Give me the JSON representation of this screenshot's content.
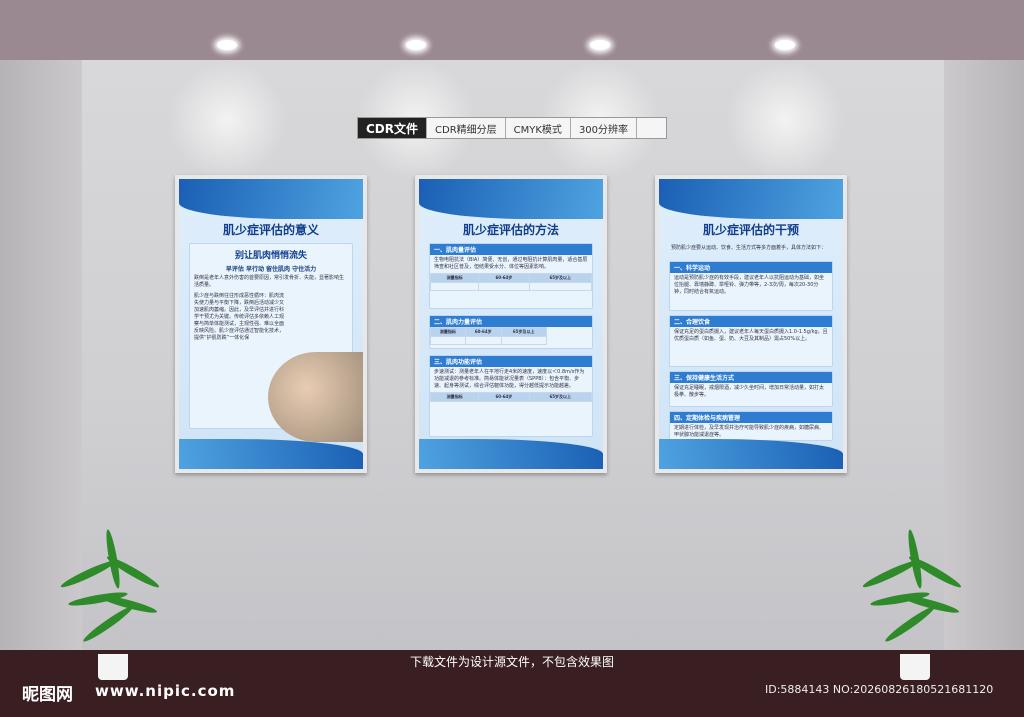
{
  "top_tags": [
    "CDR文件",
    "CDR精细分层",
    "CMYK模式",
    "300分辨率"
  ],
  "boards": [
    {
      "title": "肌少症评估的意义",
      "heading": "别让肌肉悄悄流失",
      "slogan": "早评估 早行动 留住肌肉 守住活力",
      "paragraphs": [
        "跌倒是老年人意外伤害的首要原因，常引发骨折、失能，显著影响生活质量。",
        "肌少症与跌倒往往形成恶性循环：肌肉流失使力量与平衡下降，跌倒后活动减少又加速肌肉萎缩。因此，及早评估并进行科学干预尤为关键。传统评估多依赖人工观察与简单体能测试，主观性强、难以全面反映风险。肌少症评估通过智能化技术，提供“护肌防跌”一体化保"
      ]
    },
    {
      "title": "肌少症评估的方法",
      "sections": [
        {
          "h": "一、肌肉量评估",
          "text": "生物电阻抗法（BIA）简便、无创，通过电阻抗计算肌肉量，适合基层筛查和社区普及，但结果受水分、体位等因素影响。"
        },
        {
          "h": "二、肌肉力量评估",
          "text": ""
        },
        {
          "h": "三、肌肉功能评估",
          "text": "步速测试：测量老年人在平地行走4米的速度，速度以＜0.8m/s作为功能减退的参考标准。简易体能状况量表（SPPB）：包含平衡、步速、起身等测试，综合评估躯体功能，得分越低提示功能越差。"
        }
      ],
      "table_headers": [
        "测量指标",
        "60-64岁",
        "65岁及以上"
      ]
    },
    {
      "title": "肌少症评估的干预",
      "intro": "预防肌少症要从运动、饮食、生活方式等多方面着手，具体方法如下：",
      "sections": [
        {
          "h": "一、科学运动",
          "text": "运动是预防肌少症的有效手段，建议老年人以抗阻运动为基础，如坐位抬腿、靠墙静蹲、举哑铃、弹力带等，2-3次/周，每次20-30分钟，同时结合有氧运动。"
        },
        {
          "h": "二、合理饮食",
          "text": "保证充足的蛋白质摄入，建议老年人每天蛋白质摄入1.0-1.5g/kg，且优质蛋白质（如鱼、蛋、奶、大豆及其制品）需占50%以上。"
        },
        {
          "h": "三、保持健康生活方式",
          "text": "保证充足睡眠，戒烟限酒，减少久坐时间，增加日常活动量，如打太极拳、散步等。"
        },
        {
          "h": "四、定期体检与疾病管理",
          "text": "定期进行体检，及早发现并治疗可能导致肌少症的疾病，如糖尿病、甲状腺功能减退症等。"
        }
      ]
    }
  ],
  "caption": "下载文件为设计源文件，不包含效果图",
  "logo": "昵图网",
  "site": "www.nipic.com",
  "id_text": "ID:5884143 NO:20260826180521681120"
}
